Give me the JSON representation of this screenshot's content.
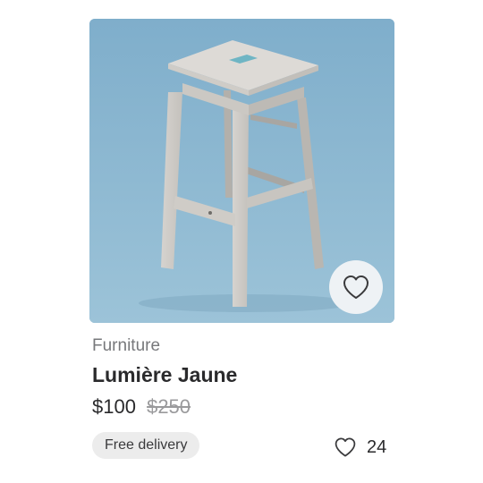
{
  "product": {
    "category": "Furniture",
    "name": "Lumière Jaune",
    "price": "$100",
    "original_price": "$250",
    "badge": "Free delivery",
    "likes": "24"
  },
  "icons": {
    "favorite": "heart-icon",
    "likes": "heart-outline-icon"
  },
  "colors": {
    "image_background": "#8cb7cf",
    "badge_background": "#ececec",
    "text_primary": "#2a2a2c",
    "text_secondary": "#77787b",
    "strikethrough": "#9a9a9c"
  }
}
